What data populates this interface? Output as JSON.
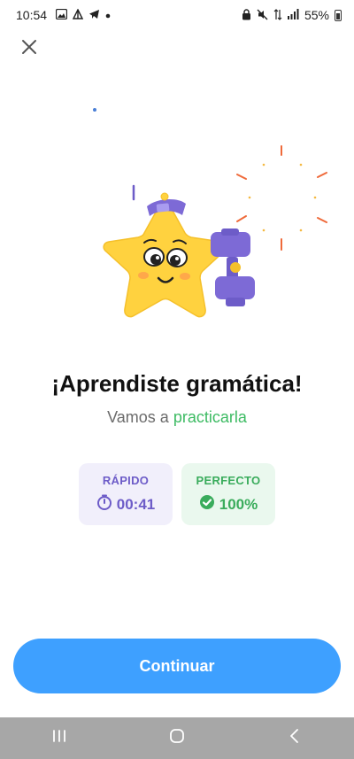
{
  "status_bar": {
    "time": "10:54",
    "battery_percent": "55%",
    "left_icons": [
      "image-icon",
      "alert-icon",
      "telegram-icon",
      "dot-icon"
    ],
    "right_icons": [
      "lock-icon",
      "mute-icon",
      "data-icon",
      "signal-icon",
      "battery-icon"
    ]
  },
  "lesson_complete": {
    "title": "¡Aprendiste gramática!",
    "subtitle_prefix": "Vamos a",
    "subtitle_accent": "practicarla",
    "stats": {
      "speed_label": "RÁPIDO",
      "speed_value": "00:41",
      "accuracy_label": "PERFECTO",
      "accuracy_value": "100%"
    }
  },
  "actions": {
    "continue_label": "Continuar"
  },
  "colors": {
    "primary": "#3ea0ff",
    "accent_green": "#3dbb63",
    "accent_purple": "#6d5cc8",
    "star": "#ffd23f"
  },
  "icons": {
    "close": "close-icon",
    "timer": "timer-icon",
    "check": "check-circle-icon",
    "nav_recent": "recents-icon",
    "nav_home": "home-icon",
    "nav_back": "back-icon"
  }
}
